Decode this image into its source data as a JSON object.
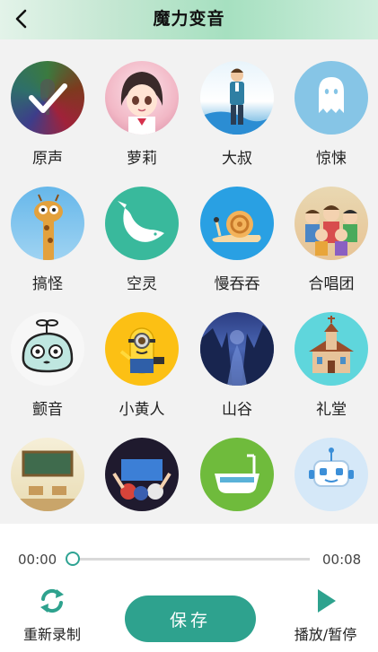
{
  "header": {
    "title": "魔力变音",
    "back_icon": "chevron-left-icon"
  },
  "effects": [
    {
      "id": "original",
      "label": "原声",
      "icon": "microphone-check-icon",
      "selected": true
    },
    {
      "id": "loli",
      "label": "萝莉",
      "icon": "anime-girl-icon"
    },
    {
      "id": "uncle",
      "label": "大叔",
      "icon": "man-in-suit-icon"
    },
    {
      "id": "thriller",
      "label": "惊悚",
      "icon": "ghost-icon"
    },
    {
      "id": "funny",
      "label": "搞怪",
      "icon": "giraffe-icon"
    },
    {
      "id": "ethereal",
      "label": "空灵",
      "icon": "whale-icon"
    },
    {
      "id": "slow",
      "label": "慢吞吞",
      "icon": "snail-icon"
    },
    {
      "id": "chorus",
      "label": "合唱团",
      "icon": "choir-icon"
    },
    {
      "id": "tremolo",
      "label": "颤音",
      "icon": "cartoon-face-icon"
    },
    {
      "id": "minion",
      "label": "小黄人",
      "icon": "minion-icon"
    },
    {
      "id": "valley",
      "label": "山谷",
      "icon": "valley-icon"
    },
    {
      "id": "chapel",
      "label": "礼堂",
      "icon": "chapel-icon"
    },
    {
      "id": "classroom",
      "label": "",
      "icon": "classroom-icon"
    },
    {
      "id": "concert",
      "label": "",
      "icon": "concert-icon"
    },
    {
      "id": "bathroom",
      "label": "",
      "icon": "bathtub-icon"
    },
    {
      "id": "robot",
      "label": "",
      "icon": "robot-icon"
    }
  ],
  "player": {
    "current_time": "00:00",
    "total_time": "00:08",
    "progress": 0,
    "rerecord_label": "重新录制",
    "save_label": "保存",
    "play_pause_label": "播放/暂停"
  },
  "colors": {
    "accent": "#2ea28e",
    "grid_bg": "#f2f2f2"
  }
}
